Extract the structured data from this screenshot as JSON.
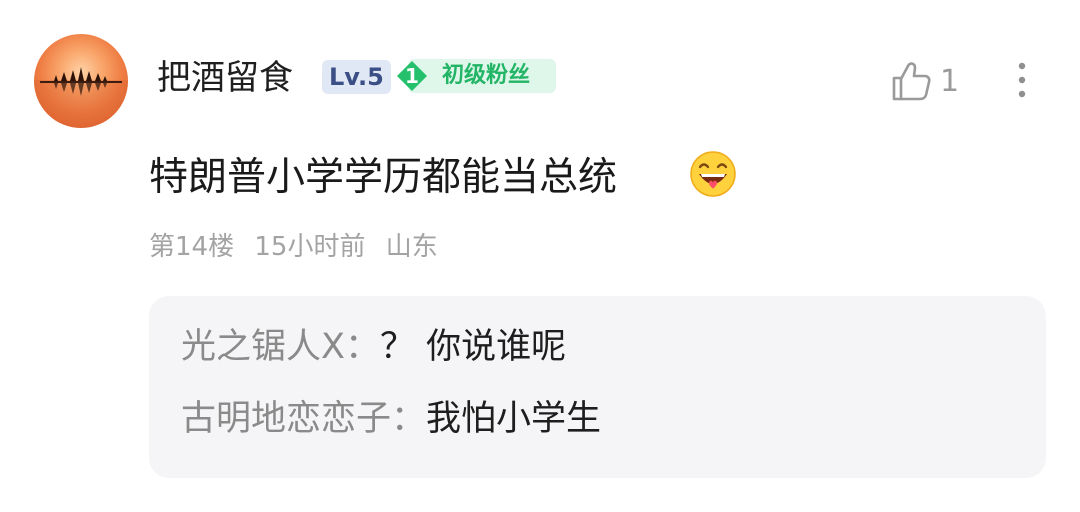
{
  "comment": {
    "author": {
      "name": "把酒留食",
      "avatar_icon": "sunset-avatar-icon",
      "level": "Lv.5",
      "fan_badge": {
        "number": "1",
        "label": "初级粉丝",
        "color": "#22b566"
      }
    },
    "like": {
      "icon": "thumbs-up-icon",
      "count": "1"
    },
    "more_icon": "more-vertical-icon",
    "text": "特朗普小学学历都能当总统",
    "emoji": "grinning-emoji-icon",
    "meta": {
      "floor": "第14楼",
      "time": "15小时前",
      "location": "山东"
    },
    "replies": [
      {
        "author": "光之锯人X",
        "separator": "：",
        "text": "？ 你说谁呢"
      },
      {
        "author": "古明地恋恋子",
        "separator": "：",
        "text": "我怕小学生"
      }
    ]
  }
}
